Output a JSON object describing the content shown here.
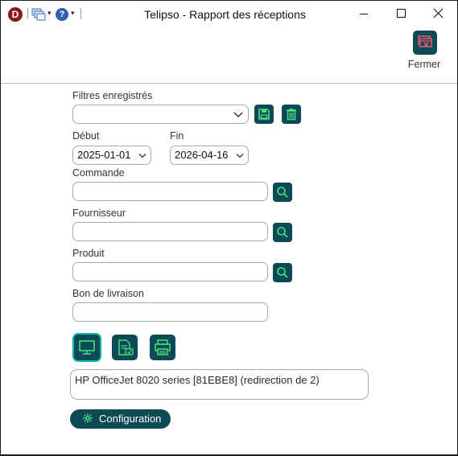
{
  "window": {
    "title": "Telipso - Rapport des réceptions",
    "app_icon_letter": "D",
    "help_glyph": "?"
  },
  "toolbar": {
    "close_label": "Fermer"
  },
  "filters": {
    "saved_filters_label": "Filtres enregistrés",
    "saved_filters_value": ""
  },
  "dates": {
    "start_label": "Début",
    "start_value": "2025-01-01",
    "end_label": "Fin",
    "end_value": "2026-04-16"
  },
  "fields": {
    "order_label": "Commande",
    "order_value": "",
    "supplier_label": "Fournisseur",
    "supplier_value": "",
    "product_label": "Produit",
    "product_value": "",
    "delivery_note_label": "Bon de livraison",
    "delivery_note_value": ""
  },
  "output": {
    "printer_text": "HP OfficeJet 8020 series [81EBE8] (redirection de 2)"
  },
  "config": {
    "label": "Configuration"
  },
  "colors": {
    "tile": "#0c4a55",
    "accent_green": "#4ade80",
    "active_outline": "#14b8a6",
    "close_icon_red": "#e8546a"
  },
  "icons": {
    "app": "app-logo-icon",
    "windows": "windows-list-icon",
    "help": "help-icon",
    "close_report": "close-report-icon",
    "save": "save-icon",
    "delete": "trash-icon",
    "search": "search-icon",
    "screen": "monitor-icon",
    "export": "export-file-icon",
    "print": "printer-icon",
    "settings": "gear-icon"
  }
}
